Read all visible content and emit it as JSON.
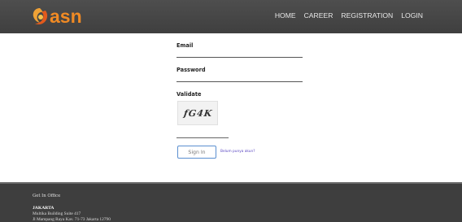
{
  "brand": {
    "logo_text": "asn",
    "logo_color": "#f08a24",
    "logo_icon": "asn-logo-icon"
  },
  "nav": {
    "items": [
      {
        "label": "HOME"
      },
      {
        "label": "CAREER"
      },
      {
        "label": "REGISTRATION"
      },
      {
        "label": "LOGIN"
      }
    ]
  },
  "form": {
    "email_label": "Email",
    "email_value": "",
    "password_label": "Password",
    "password_value": "",
    "validate_label": "Validate",
    "captcha_text": "fG4K",
    "captcha_value": "",
    "signin_label": "Sign In",
    "register_link": "Belum punya akun?",
    "button_border_color": "#5b8fd0",
    "link_color": "#5b48c2"
  },
  "footer": {
    "title": "Get In Office",
    "city": "JAKARTA",
    "address_line1": "Multika Building Suite 417",
    "address_line2": "Jl Mampang Raya Kav. 71-73 Jakarta 12790",
    "background_color": "#3e3e3e"
  },
  "header": {
    "background_color": "#4a4a4a"
  }
}
